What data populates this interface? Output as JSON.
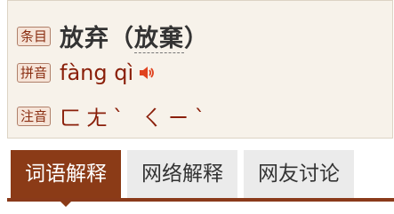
{
  "entry": {
    "label_entry": "条目",
    "headword_main": "放弃",
    "headword_paren_open": "（",
    "headword_variant": "放棄",
    "headword_paren_close": "）",
    "label_pinyin": "拼音",
    "pinyin": "fàng qì",
    "label_zhuyin": "注音",
    "zhuyin": "ㄈㄤˋ ㄑㄧˋ"
  },
  "tabs": [
    {
      "label": "词语解释",
      "active": true
    },
    {
      "label": "网络解释",
      "active": false
    },
    {
      "label": "网友讨论",
      "active": false
    }
  ],
  "icons": {
    "speaker": "speaker-icon"
  },
  "colors": {
    "accent": "#8b3b17",
    "text_red": "#8a1f0a",
    "speaker": "#e0431f"
  }
}
